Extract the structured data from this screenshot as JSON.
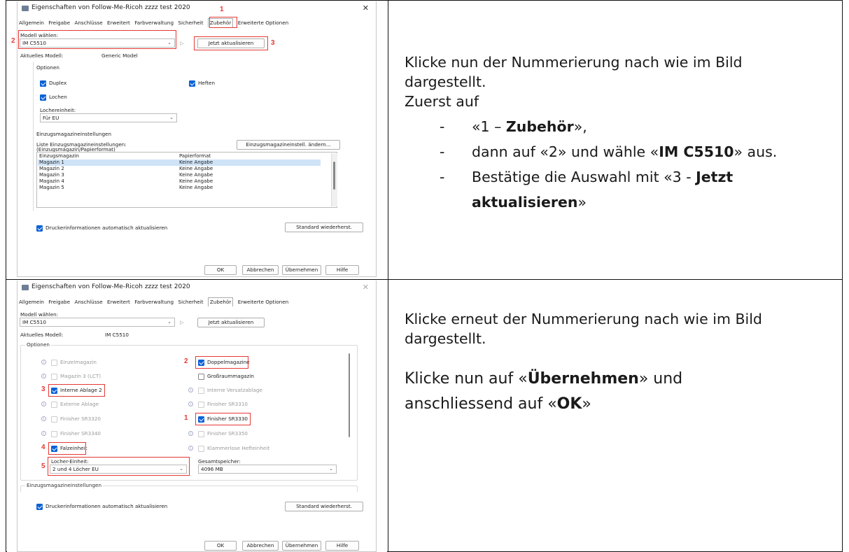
{
  "dialog1": {
    "title": "Eigenschaften von Follow-Me-Ricoh zzzz test 2020",
    "tabs": [
      "Allgemein",
      "Freigabe",
      "Anschlüsse",
      "Erweitert",
      "Farbverwaltung",
      "Sicherheit",
      "Zubehör",
      "Erweiterte Optionen"
    ],
    "model_label": "Modell wählen:",
    "model_value": "IM C5510",
    "update_button": "Jetzt aktualisieren",
    "current_model_label": "Aktuelles Modell:",
    "current_model_value": "Generic Model",
    "options_group": "Optionen",
    "opt_duplex": "Duplex",
    "opt_heften": "Heften",
    "opt_lochen": "Lochen",
    "punch_unit_label": "Lochereinheit:",
    "punch_unit_value": "Für EU",
    "tray_group": "Einzugsmagazineinstellungen",
    "tray_list_label": "Liste Einzugsmagazineinstellungen:",
    "tray_list_sub": "(Einzugsmagazin/Papierformat)",
    "tray_change_button": "Einzugsmagazineinstell. ändern...",
    "tray_columns": [
      "Einzugsmagazin",
      "Papierformat"
    ],
    "tray_rows": [
      [
        "Magazin 1",
        "Keine Angabe"
      ],
      [
        "Magazin 2",
        "Keine Angabe"
      ],
      [
        "Magazin 3",
        "Keine Angabe"
      ],
      [
        "Magazin 4",
        "Keine Angabe"
      ],
      [
        "Magazin 5",
        "Keine Angabe"
      ]
    ],
    "auto_update": "Druckerinformationen automatisch aktualisieren",
    "defaults_button": "Standard wiederherst.",
    "ok": "OK",
    "cancel": "Abbrechen",
    "apply": "Übernehmen",
    "help": "Hilfe",
    "markers": [
      "1",
      "2",
      "3"
    ]
  },
  "dialog2": {
    "title": "Eigenschaften von Follow-Me-Ricoh zzzz test 2020",
    "tabs": [
      "Allgemein",
      "Freigabe",
      "Anschlüsse",
      "Erweitert",
      "Farbverwaltung",
      "Sicherheit",
      "Zubehör",
      "Erweiterte Optionen"
    ],
    "model_label": "Modell wählen:",
    "model_value": "IM C5510",
    "update_button": "Jetzt aktualisieren",
    "current_model_label": "Aktuelles Modell:",
    "current_model_value": "IM C5510",
    "options_group": "Optionen",
    "left_options": [
      "Einzelmagazin",
      "Magazin 3 (LCT)",
      "Interne Ablage 2",
      "Externe Ablage",
      "Finisher SR3320",
      "Finisher SR3340",
      "Falzeinheit"
    ],
    "right_options": [
      "Doppelmagazine",
      "Großraummagazin",
      "Interne Versatzablage",
      "Finisher SR3310",
      "Finisher SR3330",
      "Finisher SR3350",
      "Klammerlose Hefteinheit"
    ],
    "punch_unit_label": "Locher-Einheit:",
    "punch_unit_value": "2 und 4 Löcher EU",
    "memory_label": "Gesamtspeicher:",
    "memory_value": "4096 MB",
    "tray_group": "Einzugsmagazineinstellungen",
    "auto_update": "Druckerinformationen automatisch aktualisieren",
    "defaults_button": "Standard wiederherst.",
    "ok": "OK",
    "cancel": "Abbrechen",
    "apply": "Übernehmen",
    "help": "Hilfe",
    "markers": [
      "1",
      "2",
      "3",
      "4",
      "5"
    ]
  },
  "instructions1": {
    "line1": "Klicke nun der Nummerierung nach wie im Bild",
    "line2": "dargestellt.",
    "line3": "Zuerst auf",
    "b1_pre": "«1 – ",
    "b1_bold": "Zubehör",
    "b1_post": "»,",
    "b2_pre": "dann auf «2» und wähle «",
    "b2_bold": "IM C5510",
    "b2_post": "» aus.",
    "b3_pre": "Bestätige die Auswahl mit «3 - ",
    "b3_bold1": "Jetzt",
    "b3_bold2": "aktualisieren",
    "b3_post": "»",
    "dash": "-"
  },
  "instructions2": {
    "line1": "Klicke erneut der Nummerierung nach wie im Bild",
    "line2": "dargestellt.",
    "l3_pre": "Klicke nun auf «",
    "l3_bold": "Übernehmen",
    "l3_post": "» und",
    "l4_pre": "anschliessend auf «",
    "l4_bold": "OK",
    "l4_post": "»"
  }
}
